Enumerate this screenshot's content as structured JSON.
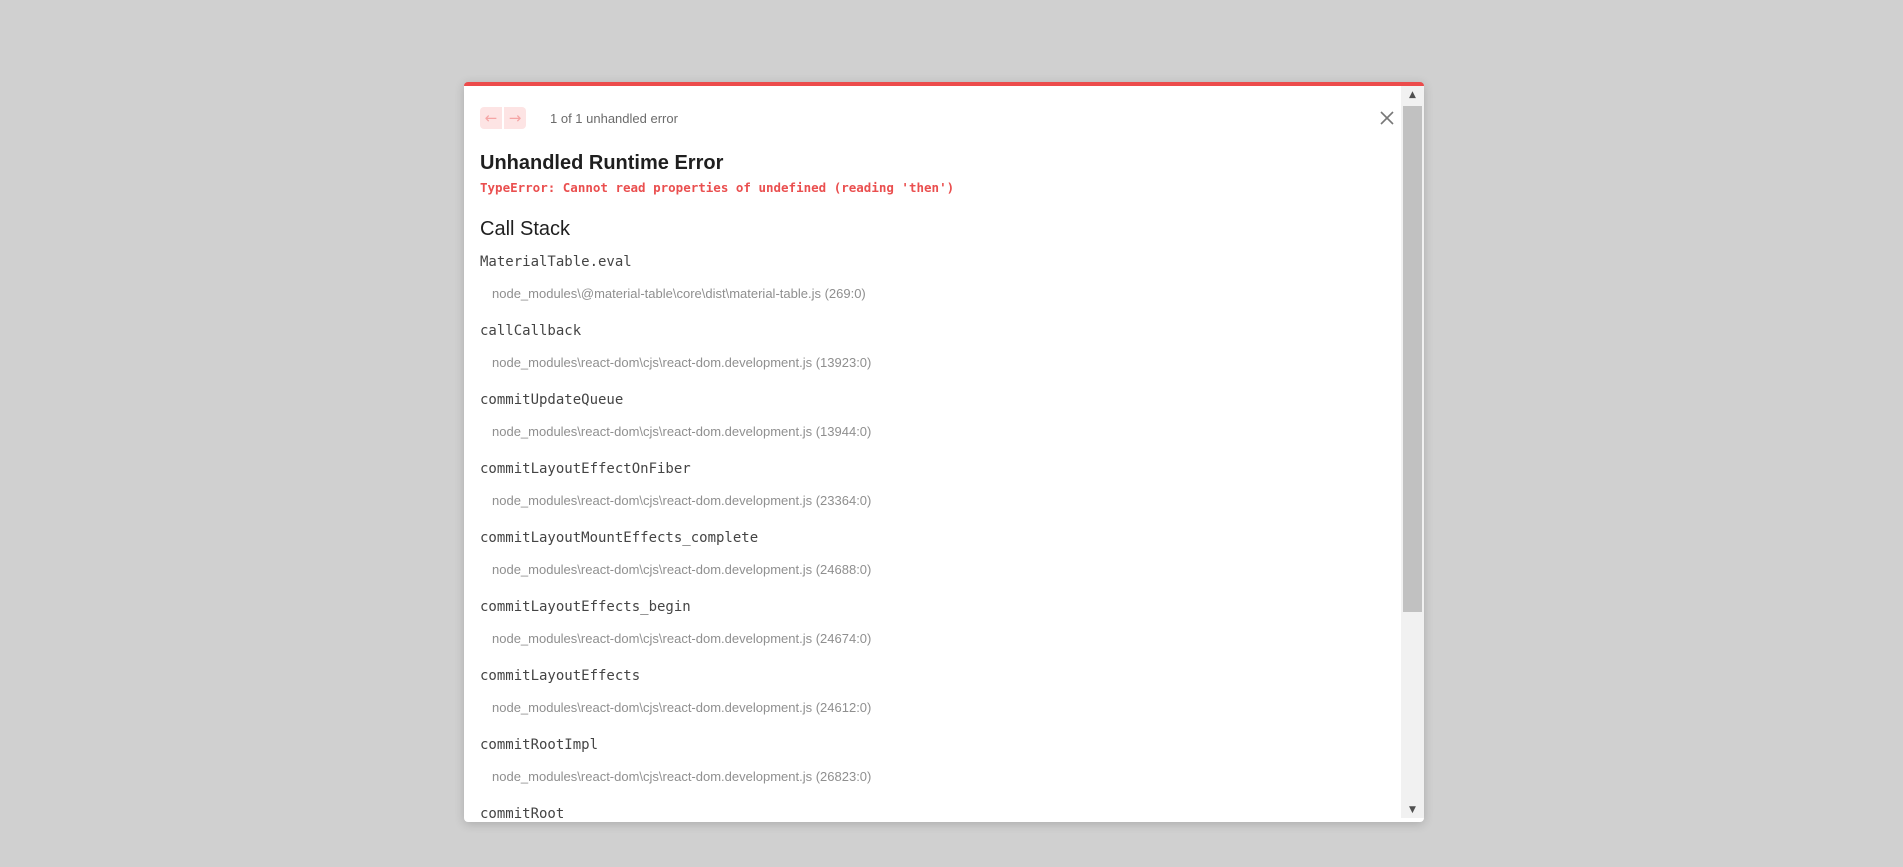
{
  "dialog": {
    "nav": {
      "prev_icon": "arrow-left-icon",
      "next_icon": "arrow-right-icon",
      "prev_glyph": "←",
      "next_glyph": "→",
      "error_count": "1 of 1 unhandled error"
    },
    "close_icon": "close-icon",
    "title": "Unhandled Runtime Error",
    "error_message": "TypeError: Cannot read properties of undefined (reading 'then')",
    "callstack_title": "Call Stack",
    "frames": [
      {
        "fn": "MaterialTable.eval",
        "file": "node_modules\\@material-table\\core\\dist\\material-table.js (269:0)"
      },
      {
        "fn": "callCallback",
        "file": "node_modules\\react-dom\\cjs\\react-dom.development.js (13923:0)"
      },
      {
        "fn": "commitUpdateQueue",
        "file": "node_modules\\react-dom\\cjs\\react-dom.development.js (13944:0)"
      },
      {
        "fn": "commitLayoutEffectOnFiber",
        "file": "node_modules\\react-dom\\cjs\\react-dom.development.js (23364:0)"
      },
      {
        "fn": "commitLayoutMountEffects_complete",
        "file": "node_modules\\react-dom\\cjs\\react-dom.development.js (24688:0)"
      },
      {
        "fn": "commitLayoutEffects_begin",
        "file": "node_modules\\react-dom\\cjs\\react-dom.development.js (24674:0)"
      },
      {
        "fn": "commitLayoutEffects",
        "file": "node_modules\\react-dom\\cjs\\react-dom.development.js (24612:0)"
      },
      {
        "fn": "commitRootImpl",
        "file": "node_modules\\react-dom\\cjs\\react-dom.development.js (26823:0)"
      },
      {
        "fn": "commitRoot",
        "file": ""
      }
    ],
    "scrollbar": {
      "up_glyph": "▲",
      "down_glyph": "▼"
    },
    "colors": {
      "accent": "#ec4b4b",
      "error_text": "#ea4f4f",
      "overlay": "#d0d0d0"
    }
  }
}
